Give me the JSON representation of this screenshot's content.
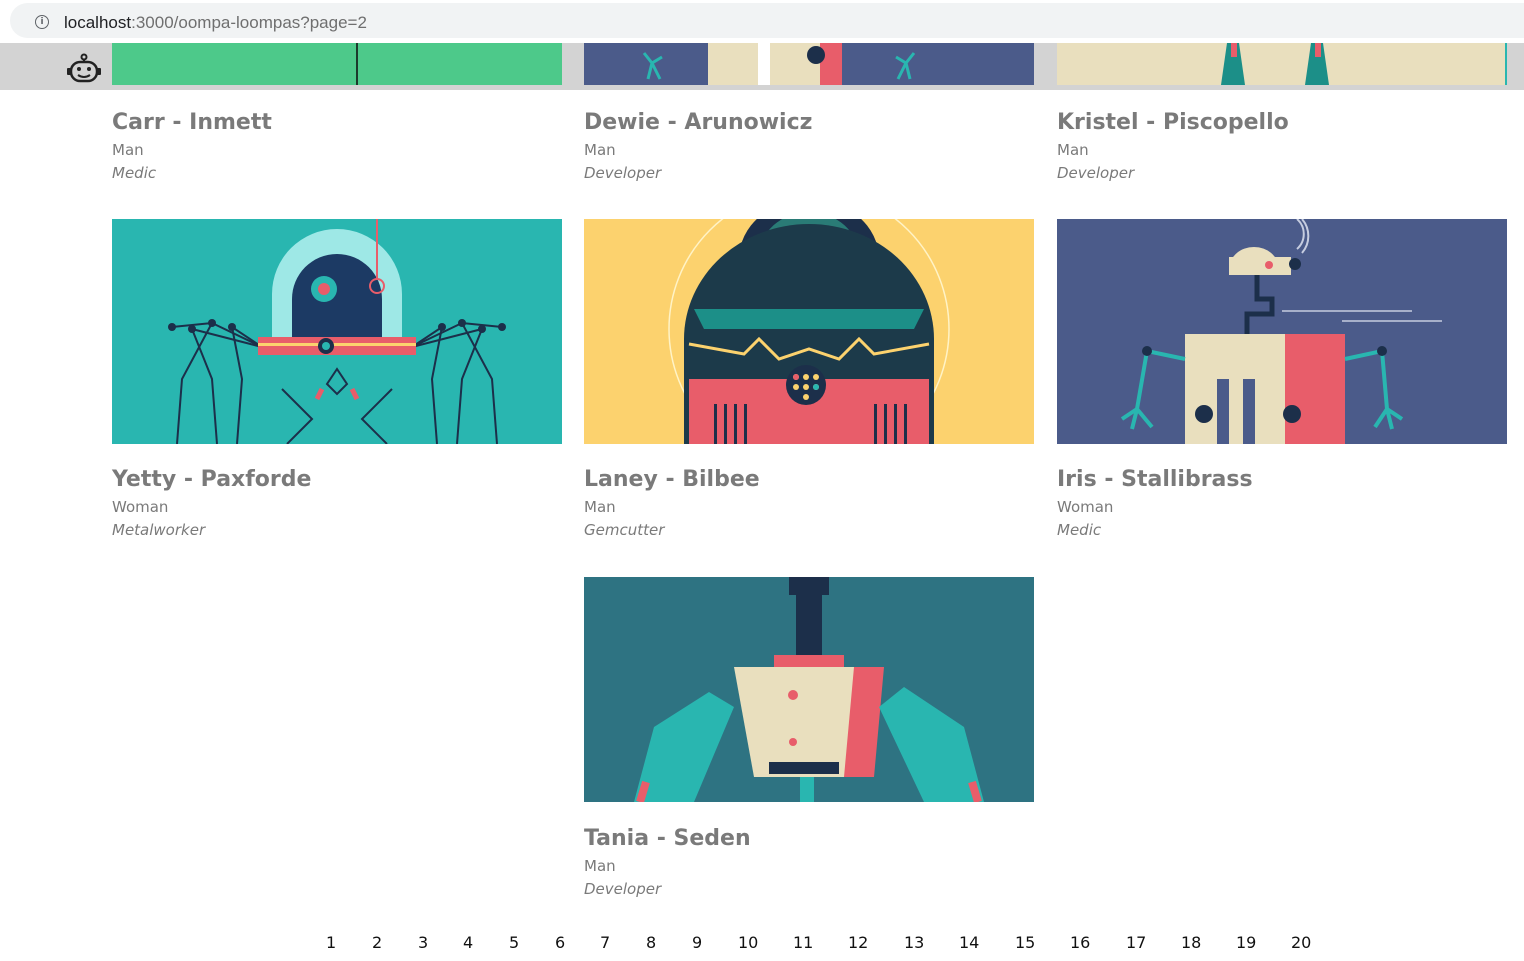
{
  "browser": {
    "url_host": "localhost",
    "url_path": ":3000/oompa-loompas?page=2"
  },
  "colors": {
    "green": "#4dc98a",
    "teal": "#29b6b0",
    "yellow": "#fcd26e",
    "slate": "#4b5b8a",
    "petrol": "#2e7382",
    "cream": "#e9dfbe",
    "coral": "#e85d6a",
    "navy": "#1c2f4a"
  },
  "top_row": [
    {
      "name": "Carr - Inmett",
      "gender": "Man",
      "profession": "Medic"
    },
    {
      "name": "Dewie - Arunowicz",
      "gender": "Man",
      "profession": "Developer"
    },
    {
      "name": "Kristel - Piscopello",
      "gender": "Man",
      "profession": "Developer"
    }
  ],
  "cards": [
    {
      "name": "Yetty - Paxforde",
      "gender": "Woman",
      "profession": "Metalworker"
    },
    {
      "name": "Laney - Bilbee",
      "gender": "Man",
      "profession": "Gemcutter"
    },
    {
      "name": "Iris - Stallibrass",
      "gender": "Woman",
      "profession": "Medic"
    },
    {
      "name": "Tania - Seden",
      "gender": "Man",
      "profession": "Developer"
    }
  ],
  "pagination": [
    "1",
    "2",
    "3",
    "4",
    "5",
    "6",
    "7",
    "8",
    "9",
    "10",
    "11",
    "12",
    "13",
    "14",
    "15",
    "16",
    "17",
    "18",
    "19",
    "20"
  ]
}
